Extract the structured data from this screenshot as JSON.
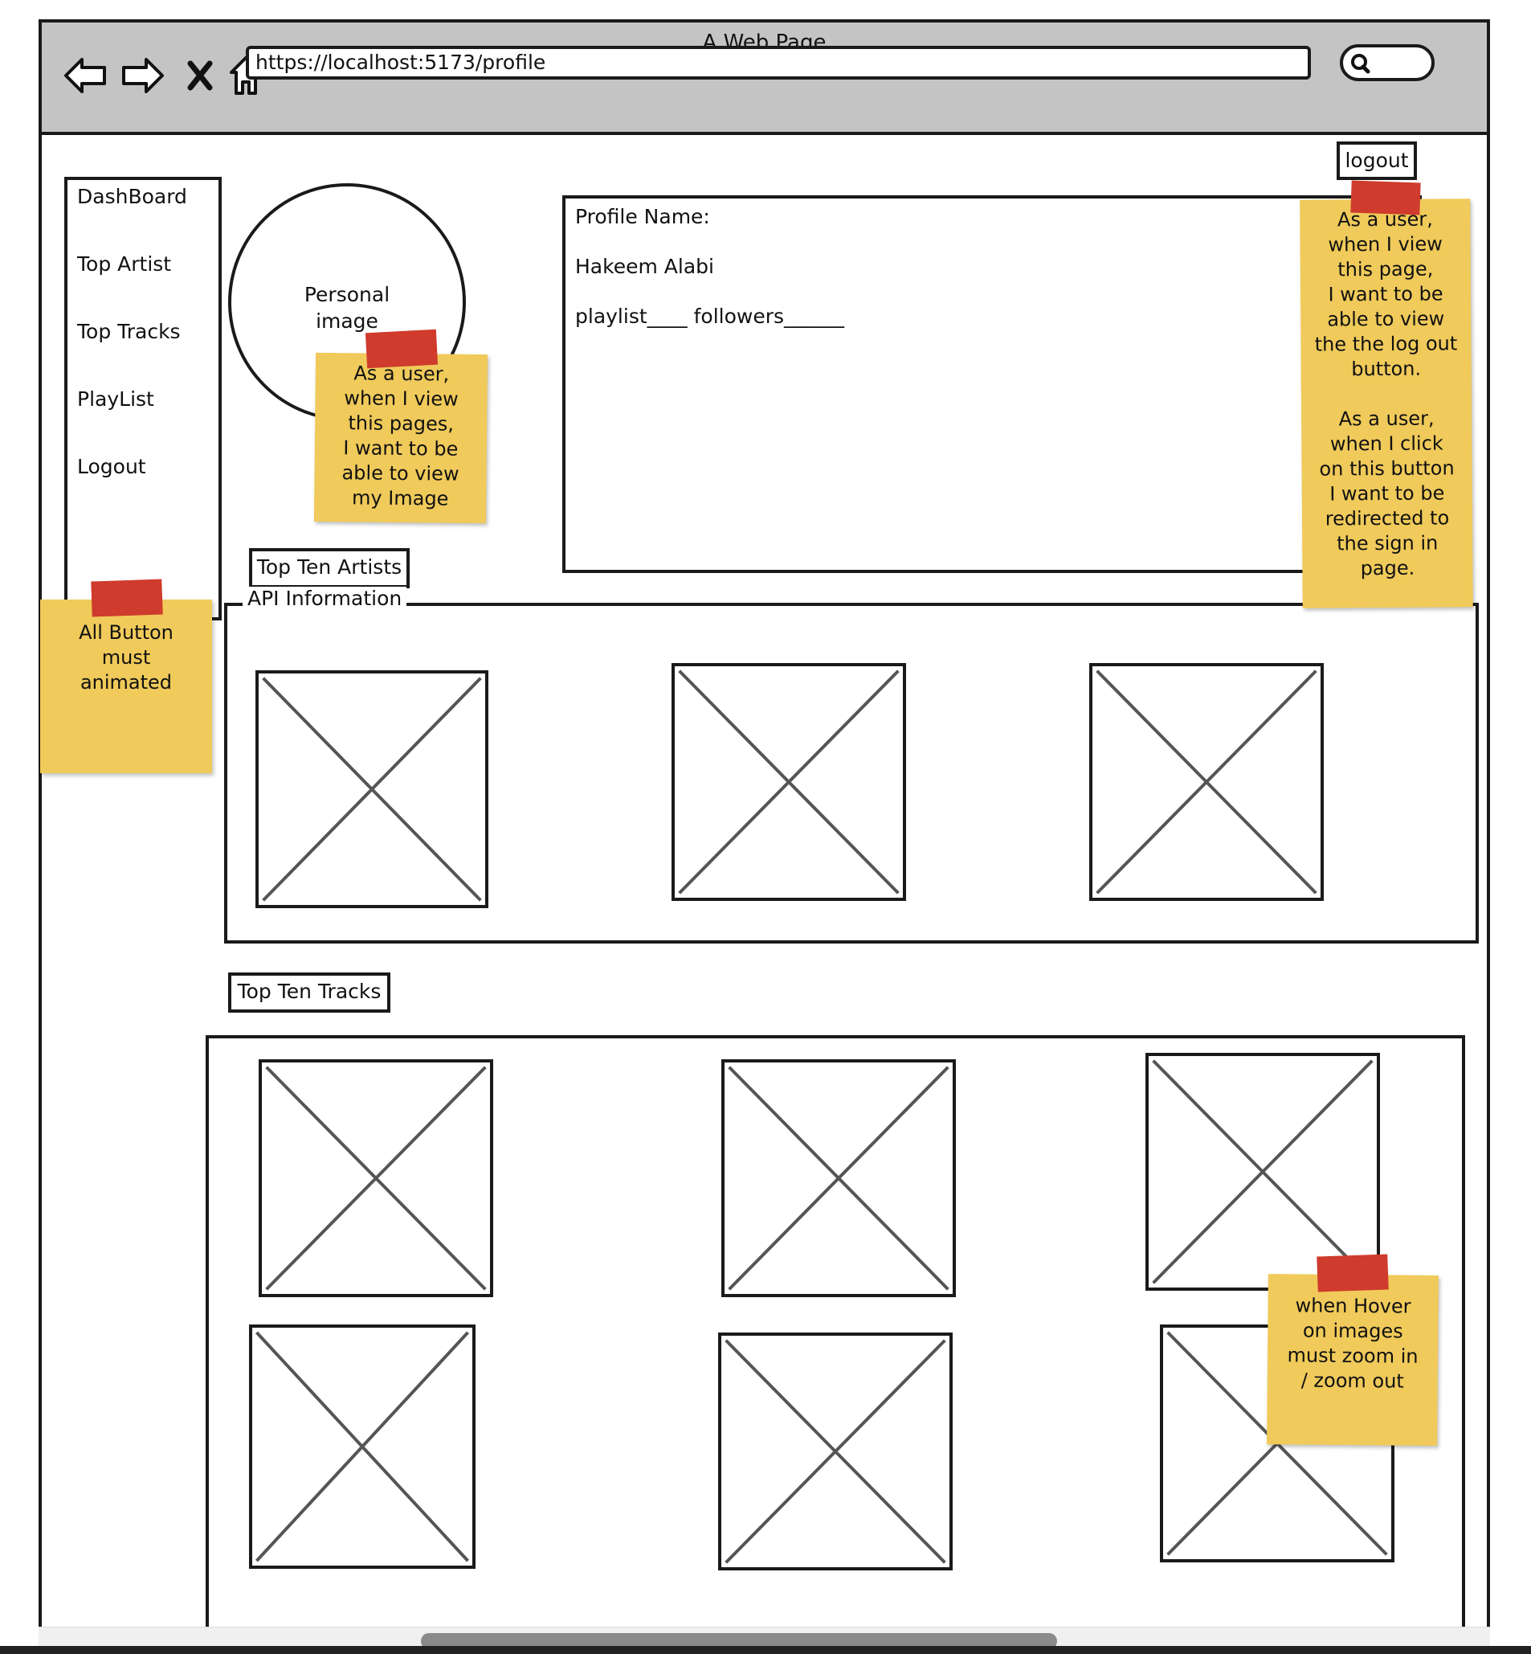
{
  "window": {
    "title": "A Web Page"
  },
  "browser": {
    "url": "https://localhost:5173/profile",
    "icons": [
      "back-arrow-icon",
      "forward-arrow-icon",
      "close-icon",
      "home-icon",
      "search-icon"
    ]
  },
  "sidebar": {
    "items": [
      {
        "label": "DashBoard"
      },
      {
        "label": "Top Artist"
      },
      {
        "label": "Top Tracks"
      },
      {
        "label": "PlayList"
      },
      {
        "label": "Logout"
      }
    ]
  },
  "avatar": {
    "label_line1": "Personal",
    "label_line2": "image"
  },
  "profile": {
    "name_label": "Profile Name:",
    "name_value": "Hakeem Alabi",
    "stats_line": "playlist____ followers______"
  },
  "header": {
    "logout_label": "logout"
  },
  "artists": {
    "button_label": "Top Ten Artists",
    "legend": "API  Information",
    "placeholder_count": 3
  },
  "tracks": {
    "button_label": "Top Ten Tracks",
    "placeholder_count": 6
  },
  "notes": {
    "image_note": [
      "As a user,",
      "when I view",
      "this pages,",
      "I want to be",
      "able to view",
      "my Image"
    ],
    "logout_note": [
      "As a user,",
      "when I view",
      "this page,",
      "I want to be",
      "able to view",
      "the the log out",
      "button.",
      "",
      "As a user,",
      "when I click",
      "on this button",
      "I want to be",
      "redirected to",
      "the sign in",
      "page."
    ],
    "button_note": [
      "All Button",
      "must",
      "animated"
    ],
    "hover_note": [
      "when Hover",
      "on images",
      "must zoom in",
      "/ zoom out"
    ]
  },
  "colors": {
    "sticky": "#f0ca5a",
    "tape": "#cf3b2c",
    "chrome": "#c4c4c4"
  }
}
